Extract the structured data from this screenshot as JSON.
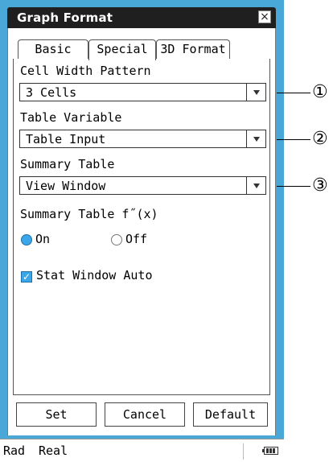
{
  "window": {
    "title": "Graph Format"
  },
  "tabs": [
    {
      "label": "Basic"
    },
    {
      "label": "Special"
    },
    {
      "label": "3D Format"
    }
  ],
  "fields": {
    "cell_width": {
      "label": "Cell Width Pattern",
      "value": "3 Cells"
    },
    "table_variable": {
      "label": "Table Variable",
      "value": "Table Input"
    },
    "summary_table": {
      "label": "Summary Table",
      "value": "View Window"
    },
    "summary_fx": {
      "label": "Summary Table f˝(x)",
      "on_label": "On",
      "off_label": "Off",
      "selected": "On"
    },
    "stat_window": {
      "label": "Stat Window Auto",
      "checked": true
    }
  },
  "buttons": {
    "set": "Set",
    "cancel": "Cancel",
    "default": "Default"
  },
  "status": {
    "angle": "Rad",
    "mode": "Real"
  },
  "callouts": [
    "①",
    "②",
    "③"
  ],
  "colors": {
    "accent": "#3aa8e8",
    "frame": "#4aa8d8",
    "titlebar": "#1f1f1f"
  }
}
